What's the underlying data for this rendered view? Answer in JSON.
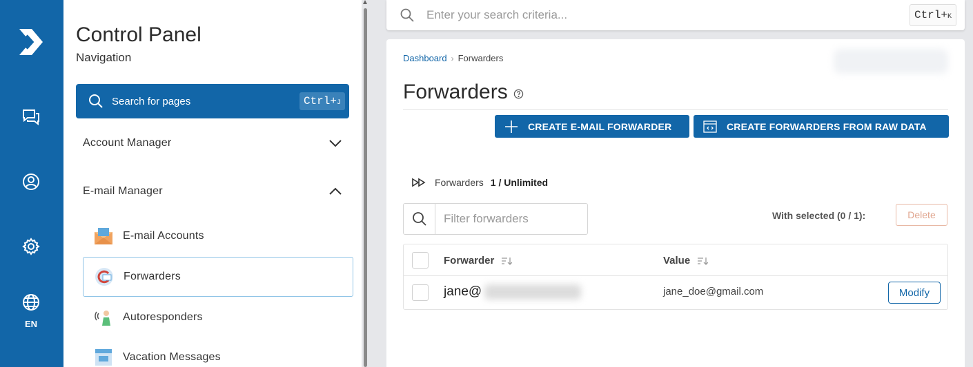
{
  "rail": {
    "language": "EN"
  },
  "nav": {
    "title": "Control Panel",
    "subtitle": "Navigation",
    "search_label": "Search for pages",
    "search_shortcut": "Ctrl+",
    "search_shortcut_key": "J",
    "groups": [
      {
        "label": "Account Manager",
        "expanded": false
      },
      {
        "label": "E-mail Manager",
        "expanded": true
      }
    ],
    "items": [
      {
        "label": "E-mail Accounts",
        "icon": "email-accounts-icon"
      },
      {
        "label": "Forwarders",
        "icon": "forwarders-icon",
        "active": true
      },
      {
        "label": "Autoresponders",
        "icon": "autoresponders-icon"
      },
      {
        "label": "Vacation Messages",
        "icon": "vacation-messages-icon"
      }
    ]
  },
  "topbar": {
    "search_placeholder": "Enter your search criteria...",
    "shortcut": "Ctrl+",
    "shortcut_key": "K"
  },
  "page": {
    "breadcrumb": [
      "Dashboard",
      "Forwarders"
    ],
    "title": "Forwarders",
    "buttons": {
      "create": "CREATE E-MAIL FORWARDER",
      "create_raw": "CREATE FORWARDERS FROM RAW DATA"
    },
    "stat_label": "Forwarders",
    "stat_value": "1 / Unlimited",
    "filter_placeholder": "Filter forwarders",
    "with_selected": "With selected (0 / 1):",
    "delete_label": "Delete",
    "table": {
      "columns": [
        "Forwarder",
        "Value"
      ],
      "rows": [
        {
          "forwarder": "jane@",
          "value": "jane_doe@gmail.com",
          "action": "Modify"
        }
      ]
    }
  },
  "colors": {
    "primary": "#1266a8",
    "delete_disabled": "#e0a58e",
    "background": "#e6e7ea"
  }
}
